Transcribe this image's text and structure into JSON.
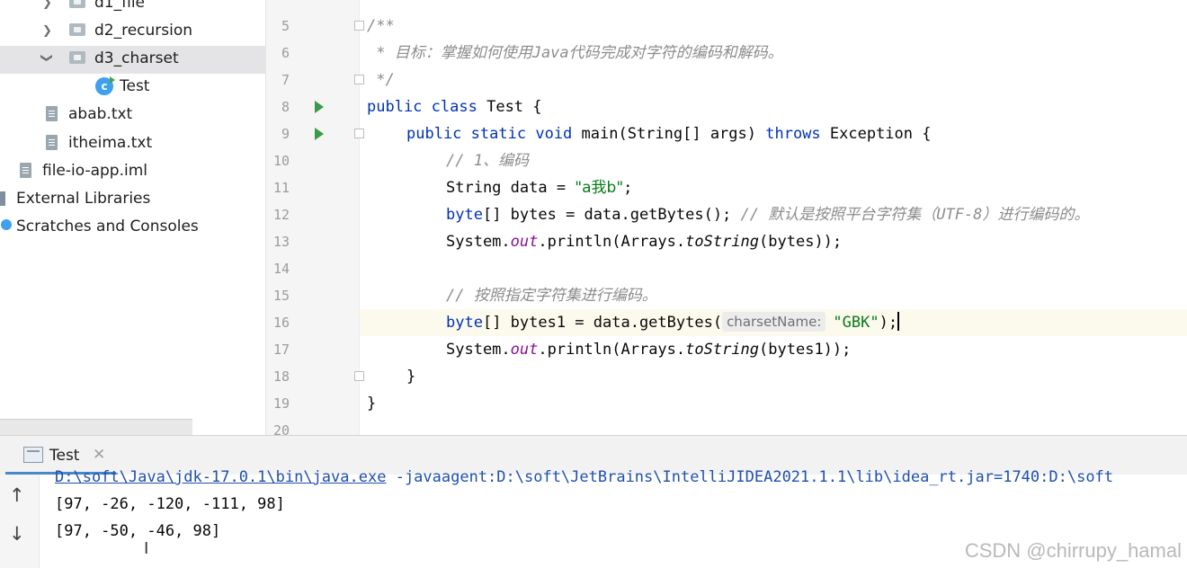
{
  "project_tree": {
    "items": [
      {
        "label": "d1_file",
        "expanded": false,
        "icon": "folder-icon"
      },
      {
        "label": "d2_recursion",
        "expanded": false,
        "icon": "folder-icon"
      },
      {
        "label": "d3_charset",
        "expanded": true,
        "icon": "folder-icon"
      },
      {
        "label": "Test",
        "icon": "java-class-icon"
      },
      {
        "label": "abab.txt",
        "icon": "text-file-icon"
      },
      {
        "label": "itheima.txt",
        "icon": "text-file-icon"
      },
      {
        "label": "file-io-app.iml",
        "icon": "module-file-icon"
      },
      {
        "label": "External Libraries",
        "icon": "library-icon"
      },
      {
        "label": "Scratches and Consoles",
        "icon": "scratches-icon"
      }
    ]
  },
  "editor": {
    "line_numbers": [
      "5",
      "6",
      "7",
      "8",
      "9",
      "10",
      "11",
      "12",
      "13",
      "14",
      "15",
      "16",
      "17",
      "18",
      "19",
      "20"
    ],
    "current_line": "16",
    "code": {
      "l5": "/**",
      "l6": " * 目标：掌握如何使用Java代码完成对字符的编码和解码。",
      "l7": " */",
      "l8_kw1": "public",
      "l8_kw2": "class",
      "l8_rest": " Test {",
      "l9_kw1": "public",
      "l9_kw2": "static",
      "l9_kw3": "void",
      "l9_mid": " main(String[] args) ",
      "l9_kw4": "throws",
      "l9_rest": " Exception {",
      "l10": "// 1、编码",
      "l11_a": "String data = ",
      "l11_str": "\"a我b\"",
      "l11_b": ";",
      "l12_kw": "byte",
      "l12_a": "[] bytes = data.getBytes(); ",
      "l12_cm": "// 默认是按照平台字符集（UTF-8）进行编码的。",
      "l13_a": "System.",
      "l13_out": "out",
      "l13_b": ".println(Arrays.",
      "l13_ts": "toString",
      "l13_c": "(bytes));",
      "l15": "// 按照指定字符集进行编码。",
      "l16_kw": "byte",
      "l16_a": "[] bytes1 = data.getBytes(",
      "l16_hint": "charsetName:",
      "l16_str": "\"GBK\"",
      "l16_b": ");",
      "l17_a": "System.",
      "l17_out": "out",
      "l17_b": ".println(Arrays.",
      "l17_ts": "toString",
      "l17_c": "(bytes1));",
      "l18": "}",
      "l19": "}"
    }
  },
  "run_panel": {
    "tab_label": "Test",
    "close_glyph": "✕",
    "up_glyph": "↑",
    "down_glyph": "↓",
    "command_path": "D:\\soft\\Java\\jdk-17.0.1\\bin\\java.exe",
    "command_rest": " -javaagent:D:\\soft\\JetBrains\\IntelliJIDEA2021.1.1\\lib\\idea_rt.jar=1740:D:\\soft",
    "output_lines": [
      "[97, -26, -120, -111, 98]",
      "[97, -50, -46, 98]"
    ]
  },
  "watermark": "CSDN @chirrupy_hamal",
  "colors": {
    "keyword": "#0033b3",
    "comment": "#8c8c8c",
    "string": "#067d17",
    "static_field": "#871094",
    "run_gutter_icon": "#3a9a45",
    "selection_row": "#e4e4e6",
    "current_line": "#fcfaed"
  }
}
